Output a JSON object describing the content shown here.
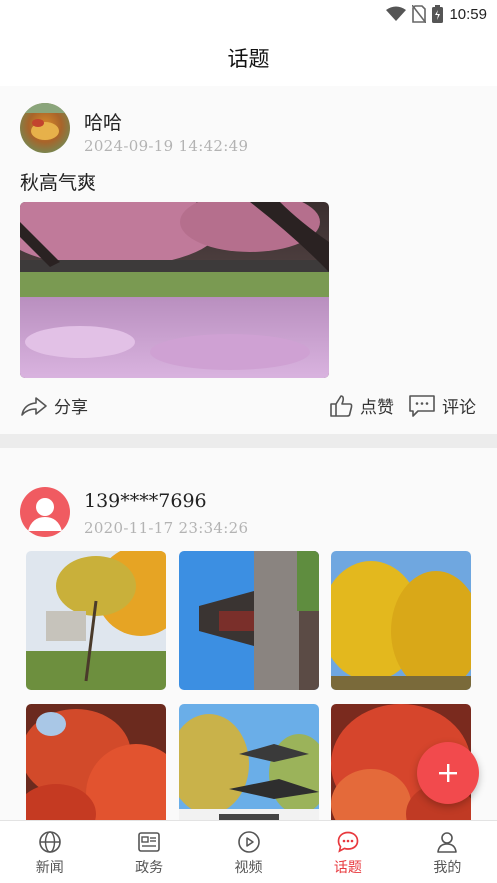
{
  "status_bar": {
    "time": "10:59",
    "icons": [
      "wifi-icon",
      "no-sim-icon",
      "battery-icon"
    ]
  },
  "header": {
    "title": "话题"
  },
  "posts": [
    {
      "author": "哈哈",
      "time": "2024-09-19  14:42:49",
      "text": "秋高气爽",
      "images": [
        "pink-blossom-park-photo"
      ],
      "actions": {
        "share": "分享",
        "like": "点赞",
        "comment": "评论"
      }
    },
    {
      "author": "139****7696",
      "time": "2020-11-17  23:34:26",
      "images": [
        "ginkgo-tree-photo",
        "tower-pavilion-photo",
        "yellow-ginkgo-photo",
        "red-maple-photo",
        "pavilion-autumn-photo",
        "red-leaves-photo"
      ]
    }
  ],
  "fab": {
    "icon": "plus-icon",
    "label": "+"
  },
  "tabs": [
    {
      "label": "新闻",
      "icon": "globe-icon",
      "active": false
    },
    {
      "label": "政务",
      "icon": "newspaper-icon",
      "active": false
    },
    {
      "label": "视频",
      "icon": "play-icon",
      "active": false
    },
    {
      "label": "话题",
      "icon": "chat-icon",
      "active": true
    },
    {
      "label": "我的",
      "icon": "person-icon",
      "active": false
    }
  ],
  "colors": {
    "accent": "#e8383d",
    "fab": "#f24a4d",
    "muted": "#b3b3b3"
  }
}
